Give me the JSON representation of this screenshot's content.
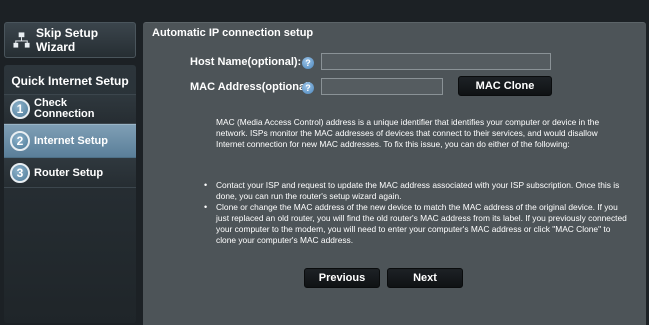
{
  "sidebar": {
    "skip_label": "Skip Setup Wizard",
    "title": "Quick Internet Setup",
    "items": [
      {
        "number": "1",
        "label_line1": "Check",
        "label_line2": "Connection",
        "active": false
      },
      {
        "number": "2",
        "label": "Internet Setup",
        "active": true
      },
      {
        "number": "3",
        "label": "Router Setup",
        "active": false
      }
    ]
  },
  "main": {
    "section_title": "Automatic IP connection setup",
    "host_name": {
      "label": "Host Name(optional):",
      "value": "",
      "help": "?"
    },
    "mac_address": {
      "label": "MAC Address(optional)",
      "value": "",
      "help": "?"
    },
    "mac_clone_label": "MAC Clone",
    "description": "MAC (Media Access Control) address is a unique identifier that identifies your computer or device in the network. ISPs monitor the MAC addresses of devices that connect to their services, and would disallow Internet connection for new MAC addresses. To fix this issue, you can do either of the following:",
    "bullets": [
      "Contact your ISP and request to update the MAC address associated with your ISP subscription. Once this is done, you can run the router's setup wizard again.",
      "Clone or change the MAC address of the new device to match the MAC address of the original device. If you just replaced an old router, you will find the old router's MAC address from its label. If you previously connected your computer to the modem, you will need to enter your computer's MAC address or click \"MAC Clone\" to clone your computer's MAC address."
    ],
    "previous_label": "Previous",
    "next_label": "Next"
  },
  "colors": {
    "background": "#1c2125",
    "panel": "#4d5458",
    "active_item": "#6f92aa",
    "button": "#15191c"
  }
}
